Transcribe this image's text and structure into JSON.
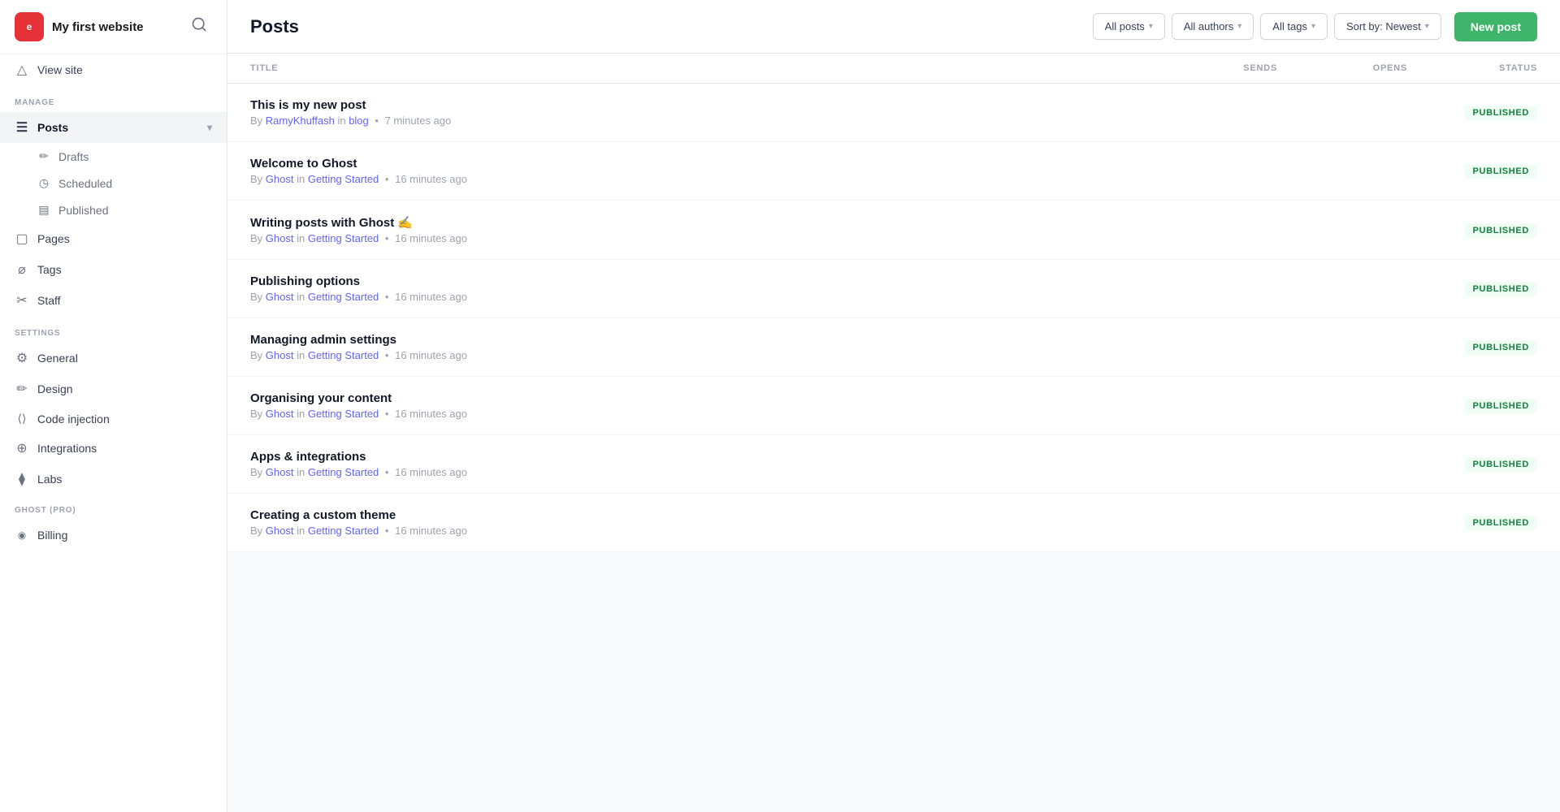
{
  "site": {
    "logo": "e",
    "name": "My first website",
    "cursor": true
  },
  "topbar": {
    "page_title": "Posts",
    "filters": {
      "all_posts": "All posts",
      "all_authors": "All authors",
      "all_tags": "All tags",
      "sort": "Sort by: Newest"
    },
    "new_post_label": "New post"
  },
  "table": {
    "headers": [
      "TITLE",
      "SENDS",
      "OPENS",
      "STATUS"
    ],
    "rows": [
      {
        "title": "This is my new post",
        "author": "RamyKhuffash",
        "preposition": "in",
        "tag": "blog",
        "time": "7 minutes ago",
        "status": "PUBLISHED"
      },
      {
        "title": "Welcome to Ghost",
        "author": "Ghost",
        "preposition": "in",
        "tag": "Getting Started",
        "time": "16 minutes ago",
        "status": "PUBLISHED"
      },
      {
        "title": "Writing posts with Ghost ✍️",
        "author": "Ghost",
        "preposition": "in",
        "tag": "Getting Started",
        "time": "16 minutes ago",
        "status": "PUBLISHED"
      },
      {
        "title": "Publishing options",
        "author": "Ghost",
        "preposition": "in",
        "tag": "Getting Started",
        "time": "16 minutes ago",
        "status": "PUBLISHED"
      },
      {
        "title": "Managing admin settings",
        "author": "Ghost",
        "preposition": "in",
        "tag": "Getting Started",
        "time": "16 minutes ago",
        "status": "PUBLISHED"
      },
      {
        "title": "Organising your content",
        "author": "Ghost",
        "preposition": "in",
        "tag": "Getting Started",
        "time": "16 minutes ago",
        "status": "PUBLISHED"
      },
      {
        "title": "Apps & integrations",
        "author": "Ghost",
        "preposition": "in",
        "tag": "Getting Started",
        "time": "16 minutes ago",
        "status": "PUBLISHED"
      },
      {
        "title": "Creating a custom theme",
        "author": "Ghost",
        "preposition": "in",
        "tag": "Getting Started",
        "time": "16 minutes ago",
        "status": "PUBLISHED"
      }
    ]
  },
  "sidebar": {
    "view_site": "View site",
    "manage_label": "MANAGE",
    "nav": [
      {
        "id": "posts",
        "label": "Posts",
        "icon": "📄",
        "active": true,
        "expanded": true
      },
      {
        "id": "pages",
        "label": "Pages",
        "icon": "🗒️"
      },
      {
        "id": "tags",
        "label": "Tags",
        "icon": "🏷️"
      },
      {
        "id": "staff",
        "label": "Staff",
        "icon": "✂️"
      }
    ],
    "sub_nav": [
      {
        "id": "drafts",
        "label": "Drafts",
        "icon": "✏️"
      },
      {
        "id": "scheduled",
        "label": "Scheduled",
        "icon": "🕐"
      },
      {
        "id": "published",
        "label": "Published",
        "icon": "📋"
      }
    ],
    "settings_label": "SETTINGS",
    "settings": [
      {
        "id": "general",
        "label": "General",
        "icon": "⚙️"
      },
      {
        "id": "design",
        "label": "Design",
        "icon": "✏️"
      },
      {
        "id": "code-injection",
        "label": "Code injection",
        "icon": "◇"
      },
      {
        "id": "integrations",
        "label": "Integrations",
        "icon": "♾️"
      },
      {
        "id": "labs",
        "label": "Labs",
        "icon": "🧪"
      }
    ],
    "ghost_label": "GHOST (PRO)",
    "ghost_nav": [
      {
        "id": "billing",
        "label": "Billing",
        "icon": "((•))"
      }
    ]
  }
}
